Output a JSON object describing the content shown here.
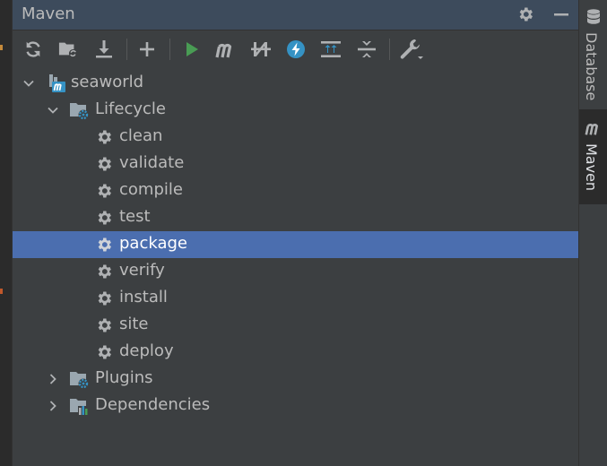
{
  "panel": {
    "title": "Maven"
  },
  "header_icons": [
    {
      "name": "gear-icon"
    },
    {
      "name": "minimize-icon"
    }
  ],
  "toolbar": [
    {
      "name": "reload-icon"
    },
    {
      "name": "generate-sources-icon"
    },
    {
      "name": "download-icon"
    },
    {
      "name": "add-icon"
    },
    {
      "name": "run-icon"
    },
    {
      "name": "execute-goal-icon"
    },
    {
      "name": "toggle-offline-icon"
    },
    {
      "name": "skip-tests-icon"
    },
    {
      "name": "show-dependencies-icon"
    },
    {
      "name": "collapse-all-icon"
    },
    {
      "name": "settings-wrench-icon"
    }
  ],
  "tree": {
    "project": "seaworld",
    "lifecycle": "Lifecycle",
    "goals": [
      "clean",
      "validate",
      "compile",
      "test",
      "package",
      "verify",
      "install",
      "site",
      "deploy"
    ],
    "selected_goal": "package",
    "plugins": "Plugins",
    "dependencies": "Dependencies"
  },
  "right_tabs": [
    {
      "label": "Database",
      "icon": "database-icon",
      "active": false
    },
    {
      "label": "Maven",
      "icon": "maven-icon",
      "active": true
    }
  ],
  "colors": {
    "panel_bg": "#3c3f41",
    "header_bg": "#3d4b5c",
    "selection": "#4b6eaf",
    "text": "#bbbbbb",
    "run_green": "#499c54",
    "accent_blue": "#3592c4"
  }
}
